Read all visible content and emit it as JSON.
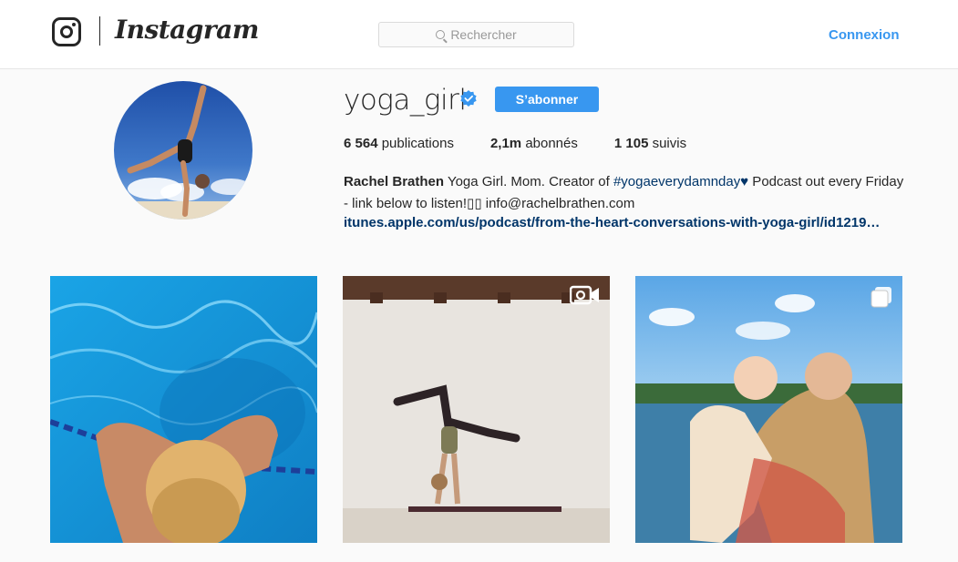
{
  "header": {
    "logo_text": "Instagram",
    "search_placeholder": "Rechercher",
    "login_label": "Connexion"
  },
  "profile": {
    "username": "yoga_girl",
    "verified": true,
    "follow_label": "S’abonner",
    "stats": {
      "posts_count": "6 564",
      "posts_label": "publications",
      "followers_count": "2,1m",
      "followers_label": "abonnés",
      "following_count": "1 105",
      "following_label": "suivis"
    },
    "bio": {
      "full_name": "Rachel Brathen",
      "text_before": " Yoga Girl. Mom. Creator of ",
      "hashtag": "#yogaeverydamnday",
      "heart": "♥",
      "text_after": " Podcast out every Friday - link below to listen!▯▯ info@rachelbrathen.com"
    },
    "link": "itunes.apple.com/us/podcast/from-the-heart-conversations-with-yoga-girl/id1219…"
  },
  "colors": {
    "accent": "#3897f0",
    "link": "#003569",
    "text": "#262626",
    "background": "#fafafa"
  },
  "posts": [
    {
      "badge": "none"
    },
    {
      "badge": "video-icon"
    },
    {
      "badge": "carousel-icon"
    }
  ]
}
